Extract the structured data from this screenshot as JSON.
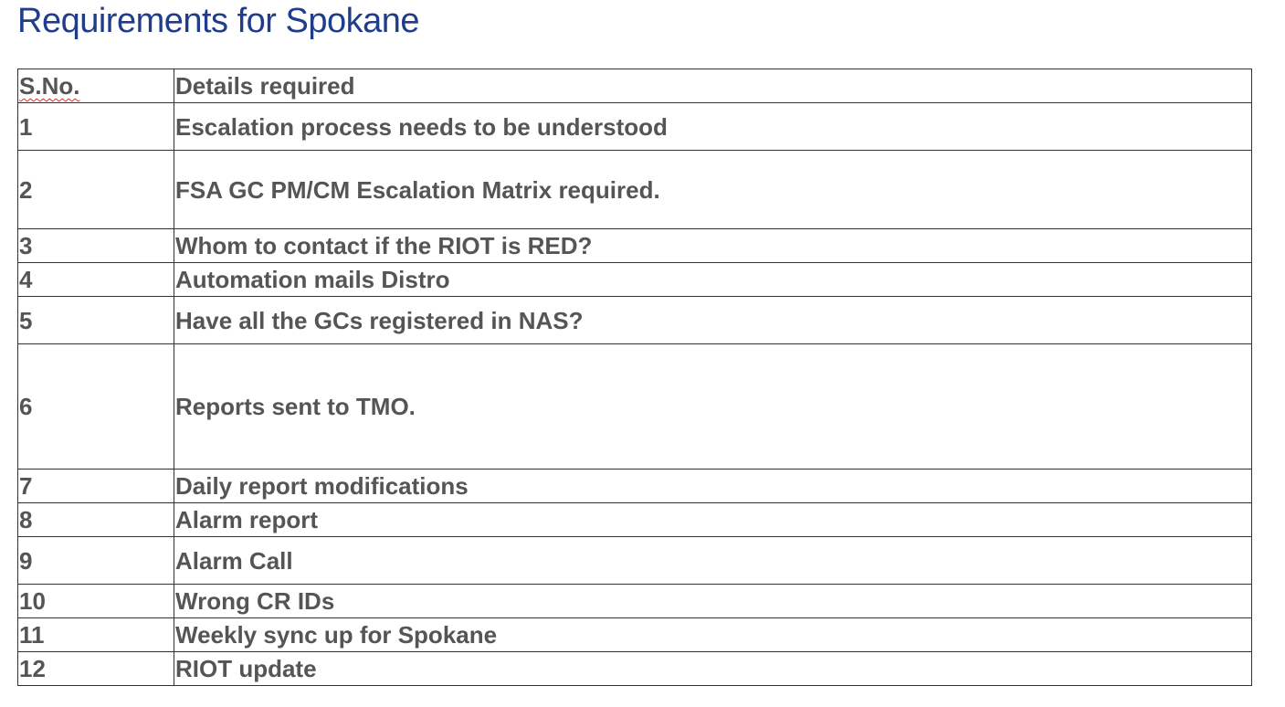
{
  "document": {
    "title": "Requirements for Spokane"
  },
  "table": {
    "headers": {
      "sno": "S.No.",
      "details": "Details required"
    },
    "rows": [
      {
        "sno": "1",
        "details": "Escalation process needs to be understood"
      },
      {
        "sno": "2",
        "details": "FSA GC PM/CM Escalation Matrix required."
      },
      {
        "sno": "3",
        "details": "Whom to contact if the RIOT is RED?"
      },
      {
        "sno": "4",
        "details": "Automation mails Distro"
      },
      {
        "sno": "5",
        "details": "Have all the GCs registered in NAS?"
      },
      {
        "sno": "6",
        "details": "Reports sent to TMO."
      },
      {
        "sno": "7",
        "details": "Daily report modifications"
      },
      {
        "sno": "8",
        "details": "Alarm report"
      },
      {
        "sno": "9",
        "details": "Alarm Call"
      },
      {
        "sno": "10",
        "details": "Wrong CR IDs"
      },
      {
        "sno": "11",
        "details": "Weekly sync up for Spokane"
      },
      {
        "sno": "12",
        "details": "RIOT update"
      }
    ]
  },
  "colors": {
    "title": "#1f3d8a",
    "cell_text": "#555555",
    "border": "#333333",
    "spellcheck_underline": "#d32f2f"
  }
}
